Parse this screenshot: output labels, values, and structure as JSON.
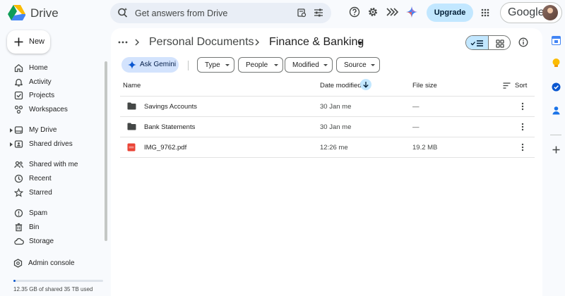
{
  "app": {
    "name": "Drive"
  },
  "search": {
    "placeholder": "Get answers from Drive"
  },
  "header": {
    "upgrade_label": "Upgrade",
    "account_label": "Google"
  },
  "sidebar": {
    "new_label": "New",
    "items": [
      {
        "label": "Home",
        "icon": "home-icon"
      },
      {
        "label": "Activity",
        "icon": "bell-icon"
      },
      {
        "label": "Projects",
        "icon": "checkbox-icon"
      },
      {
        "label": "Workspaces",
        "icon": "workspaces-icon"
      },
      {
        "label": "My Drive",
        "icon": "drive-icon"
      },
      {
        "label": "Shared drives",
        "icon": "shared-drives-icon"
      },
      {
        "label": "Shared with me",
        "icon": "people-icon"
      },
      {
        "label": "Recent",
        "icon": "clock-icon"
      },
      {
        "label": "Starred",
        "icon": "star-icon"
      },
      {
        "label": "Spam",
        "icon": "spam-icon"
      },
      {
        "label": "Bin",
        "icon": "trash-icon"
      },
      {
        "label": "Storage",
        "icon": "cloud-icon"
      },
      {
        "label": "Admin console",
        "icon": "admin-icon"
      }
    ],
    "storage": {
      "text": "12.35 GB of shared 35 TB used",
      "used_fraction": 0.02
    }
  },
  "breadcrumb": {
    "parent": "Personal Documents",
    "current": "Finance & Banking"
  },
  "filters": {
    "gemini_label": "Ask Gemini",
    "chips": [
      "Type",
      "People",
      "Modified",
      "Source"
    ]
  },
  "table": {
    "columns": {
      "name": "Name",
      "date": "Date modified",
      "size": "File size",
      "sort": "Sort"
    },
    "rows": [
      {
        "name": "Savings Accounts",
        "date": "30 Jan me",
        "size": "—",
        "kind": "folder-icon"
      },
      {
        "name": "Bank Statements",
        "date": "30 Jan me",
        "size": "—",
        "kind": "folder-icon"
      },
      {
        "name": "IMG_9762.pdf",
        "date": "12:26 me",
        "size": "19.2 MB",
        "kind": "pdf-icon"
      }
    ]
  },
  "colors": {
    "accent": "#0b57d0",
    "selected": "#c2e7ff",
    "background": "#f8fafd"
  }
}
